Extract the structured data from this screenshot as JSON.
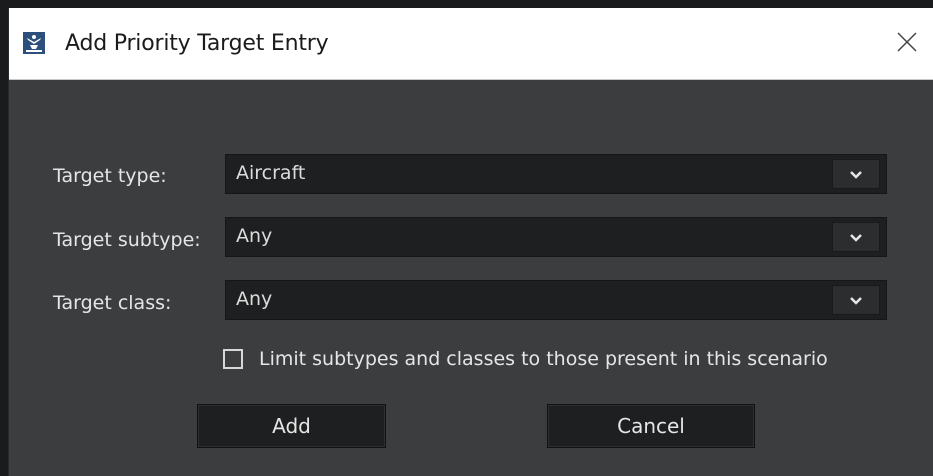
{
  "window": {
    "title": "Add Priority Target Entry",
    "icon": "app-emblem-icon",
    "close_icon": "close-icon"
  },
  "form": {
    "rows": [
      {
        "label": "Target type:",
        "value": "Aircraft"
      },
      {
        "label": "Target subtype:",
        "value": "Any"
      },
      {
        "label": "Target class:",
        "value": "Any"
      }
    ],
    "limit_checkbox": {
      "label": "Limit subtypes and classes to those present in this scenario",
      "checked": false
    }
  },
  "buttons": {
    "add_label": "Add",
    "cancel_label": "Cancel"
  },
  "colors": {
    "dialog_bg": "#3b3d3f",
    "field_bg": "#1e1f20",
    "text": "#e6e6e6",
    "titlebar_bg": "#ffffff"
  }
}
